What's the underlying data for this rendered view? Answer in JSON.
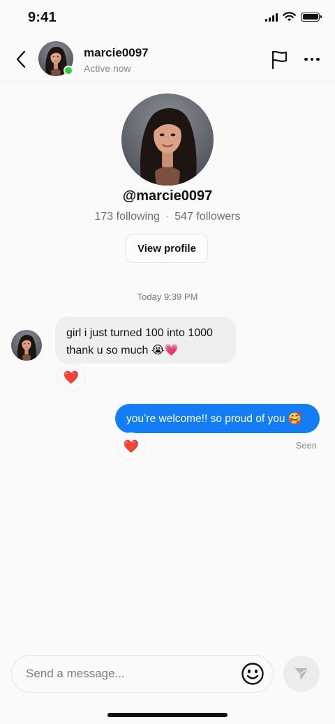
{
  "status_bar": {
    "time": "9:41",
    "icons": [
      "cellular-signal-icon",
      "wifi-icon",
      "battery-icon"
    ]
  },
  "header": {
    "username": "marcie0097",
    "presence": "Active now",
    "icons": [
      "chevron-left-icon",
      "flag-icon",
      "more-icon"
    ]
  },
  "profile": {
    "handle": "@marcie0097",
    "following": "173 following",
    "separator": "·",
    "followers": "547 followers",
    "view_profile_label": "View profile"
  },
  "conversation": {
    "timestamp": "Today 9:39 PM",
    "messages": [
      {
        "direction": "incoming",
        "text": "girl i just turned 100 into 1000 thank u so much 😭💗",
        "reaction": "❤️"
      },
      {
        "direction": "outgoing",
        "text": "you’re welcome!! so proud of you 🥰",
        "reaction": "❤️",
        "status": "Seen"
      }
    ]
  },
  "composer": {
    "placeholder": "Send a message...",
    "icons": [
      "smiley-icon",
      "send-icon"
    ]
  },
  "colors": {
    "accent_blue": "#127df5",
    "online_green": "#2ed13a",
    "incoming_bubble": "#efefef",
    "background": "#fafafa"
  }
}
